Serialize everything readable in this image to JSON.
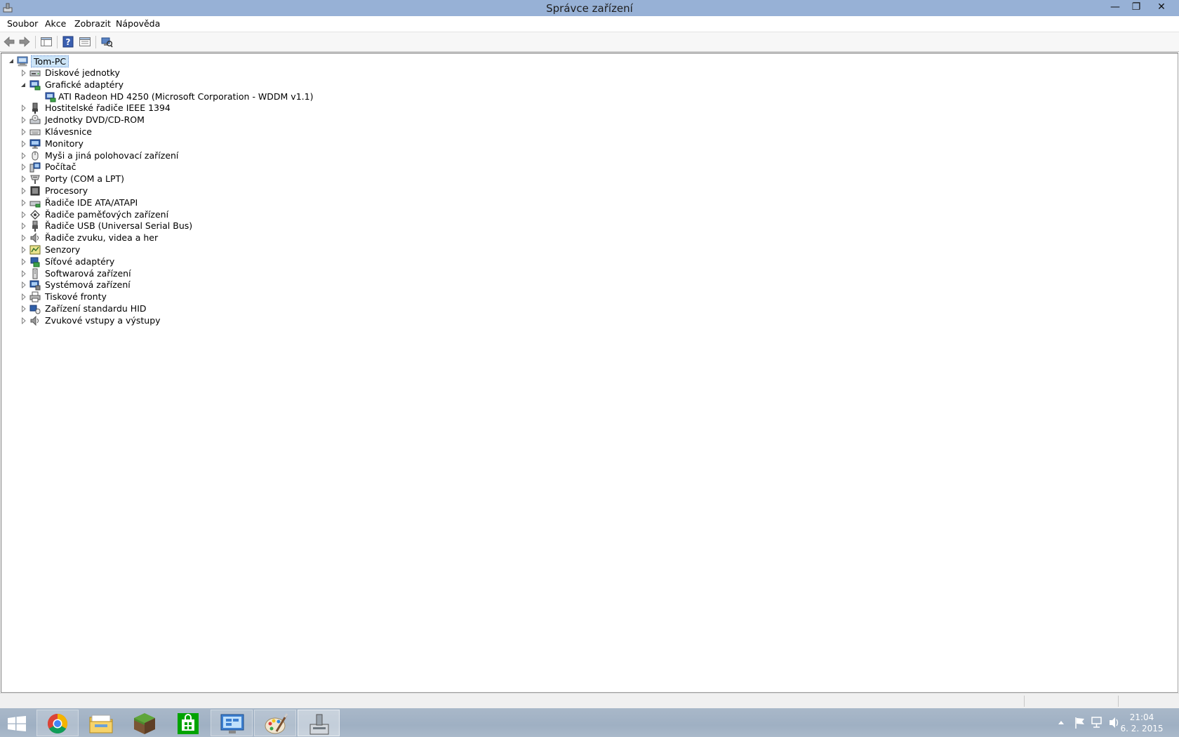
{
  "window": {
    "title": "Správce zařízení",
    "minimize_glyph": "—",
    "restore_glyph": "❐",
    "close_glyph": "✕"
  },
  "menu": {
    "items": [
      "Soubor",
      "Akce",
      "Zobrazit",
      "Nápověda"
    ]
  },
  "toolbar": {
    "buttons": [
      "back-arrow-icon",
      "forward-arrow-icon",
      "show-hide-console-tree-icon",
      "help-icon",
      "properties-icon",
      "scan-hardware-icon"
    ]
  },
  "tree": {
    "root": "Tom-PC",
    "categories": [
      {
        "label": "Diskové jednotky",
        "icon": "disk-drive-icon",
        "expanded": false
      },
      {
        "label": "Grafické adaptéry",
        "icon": "display-adapter-icon",
        "expanded": true,
        "children": [
          "ATI Radeon HD 4250 (Microsoft Corporation - WDDM v1.1)"
        ]
      },
      {
        "label": "Hostitelské řadiče IEEE 1394",
        "icon": "ieee1394-icon",
        "expanded": false
      },
      {
        "label": "Jednotky DVD/CD-ROM",
        "icon": "dvd-drive-icon",
        "expanded": false
      },
      {
        "label": "Klávesnice",
        "icon": "keyboard-icon",
        "expanded": false
      },
      {
        "label": "Monitory",
        "icon": "monitor-icon",
        "expanded": false
      },
      {
        "label": "Myši a jiná polohovací zařízení",
        "icon": "mouse-icon",
        "expanded": false
      },
      {
        "label": "Počítač",
        "icon": "computer-icon",
        "expanded": false
      },
      {
        "label": "Porty (COM a LPT)",
        "icon": "port-icon",
        "expanded": false
      },
      {
        "label": "Procesory",
        "icon": "processor-icon",
        "expanded": false
      },
      {
        "label": "Řadiče IDE ATA/ATAPI",
        "icon": "ide-controller-icon",
        "expanded": false
      },
      {
        "label": "Řadiče paměťových zařízení",
        "icon": "storage-controller-icon",
        "expanded": false
      },
      {
        "label": "Řadiče USB (Universal Serial Bus)",
        "icon": "usb-icon",
        "expanded": false
      },
      {
        "label": "Řadiče zvuku, videa a her",
        "icon": "sound-icon",
        "expanded": false
      },
      {
        "label": "Senzory",
        "icon": "sensor-icon",
        "expanded": false
      },
      {
        "label": "Síťové adaptéry",
        "icon": "network-adapter-icon",
        "expanded": false
      },
      {
        "label": "Softwarová zařízení",
        "icon": "software-device-icon",
        "expanded": false
      },
      {
        "label": "Systémová zařízení",
        "icon": "system-device-icon",
        "expanded": false
      },
      {
        "label": "Tiskové fronty",
        "icon": "printer-icon",
        "expanded": false
      },
      {
        "label": "Zařízení standardu HID",
        "icon": "hid-icon",
        "expanded": false
      },
      {
        "label": "Zvukové vstupy a výstupy",
        "icon": "audio-io-icon",
        "expanded": false
      }
    ]
  },
  "taskbar": {
    "apps": [
      "start-icon",
      "chrome-icon",
      "file-explorer-icon",
      "minecraft-icon",
      "store-icon",
      "remote-desktop-icon",
      "paint-icon",
      "device-manager-icon"
    ],
    "clock_time": "21:04",
    "clock_date": "6. 2. 2015"
  },
  "colors": {
    "title_bar": "#97b1d6",
    "selection": "#cce4f7",
    "taskbar": "#a3b3c6"
  }
}
